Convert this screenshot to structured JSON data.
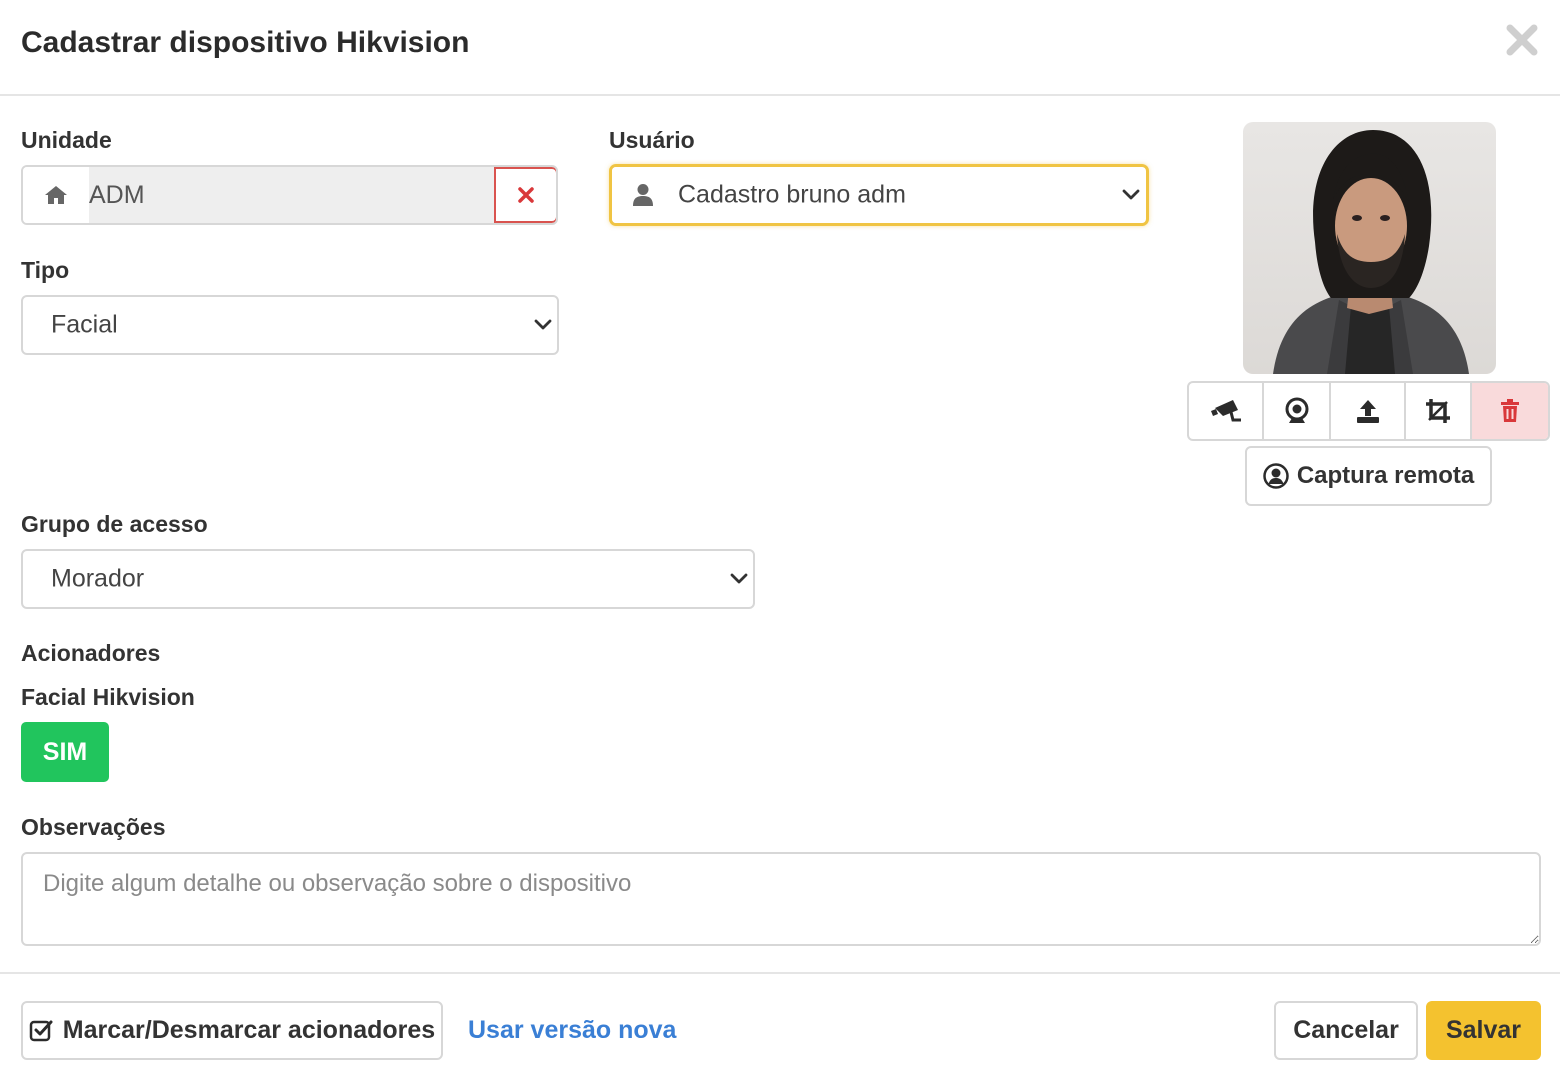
{
  "modal": {
    "title": "Cadastrar dispositivo Hikvision",
    "close_icon": "close-icon"
  },
  "form": {
    "unidade": {
      "label": "Unidade",
      "value": "ADM",
      "icon": "home-icon",
      "clear_icon": "close-icon"
    },
    "usuario": {
      "label": "Usuário",
      "value": "Cadastro bruno adm",
      "icon": "user-icon"
    },
    "tipo": {
      "label": "Tipo",
      "value": "Facial"
    },
    "grupo": {
      "label": "Grupo de acesso",
      "value": "Morador"
    },
    "acionadores": {
      "label": "Acionadores",
      "device_label": "Facial Hikvision",
      "toggle_value": "SIM",
      "toggle_color": "#21c55d"
    },
    "observacoes": {
      "label": "Observações",
      "placeholder": "Digite algum detalhe ou observação sobre o dispositivo"
    }
  },
  "photo_panel": {
    "tools": [
      "camera-icon",
      "webcam-icon",
      "upload-icon",
      "crop-icon",
      "trash-icon"
    ],
    "remote_capture_label": "Captura remota"
  },
  "footer": {
    "toggle_triggers_label": "Marcar/Desmarcar acionadores",
    "new_version_link": "Usar versão nova",
    "cancel_label": "Cancelar",
    "save_label": "Salvar"
  },
  "colors": {
    "accent_yellow": "#f4c22f",
    "link_blue": "#3a7fd5",
    "danger_red": "#d9534f",
    "success_green": "#21c55d"
  }
}
